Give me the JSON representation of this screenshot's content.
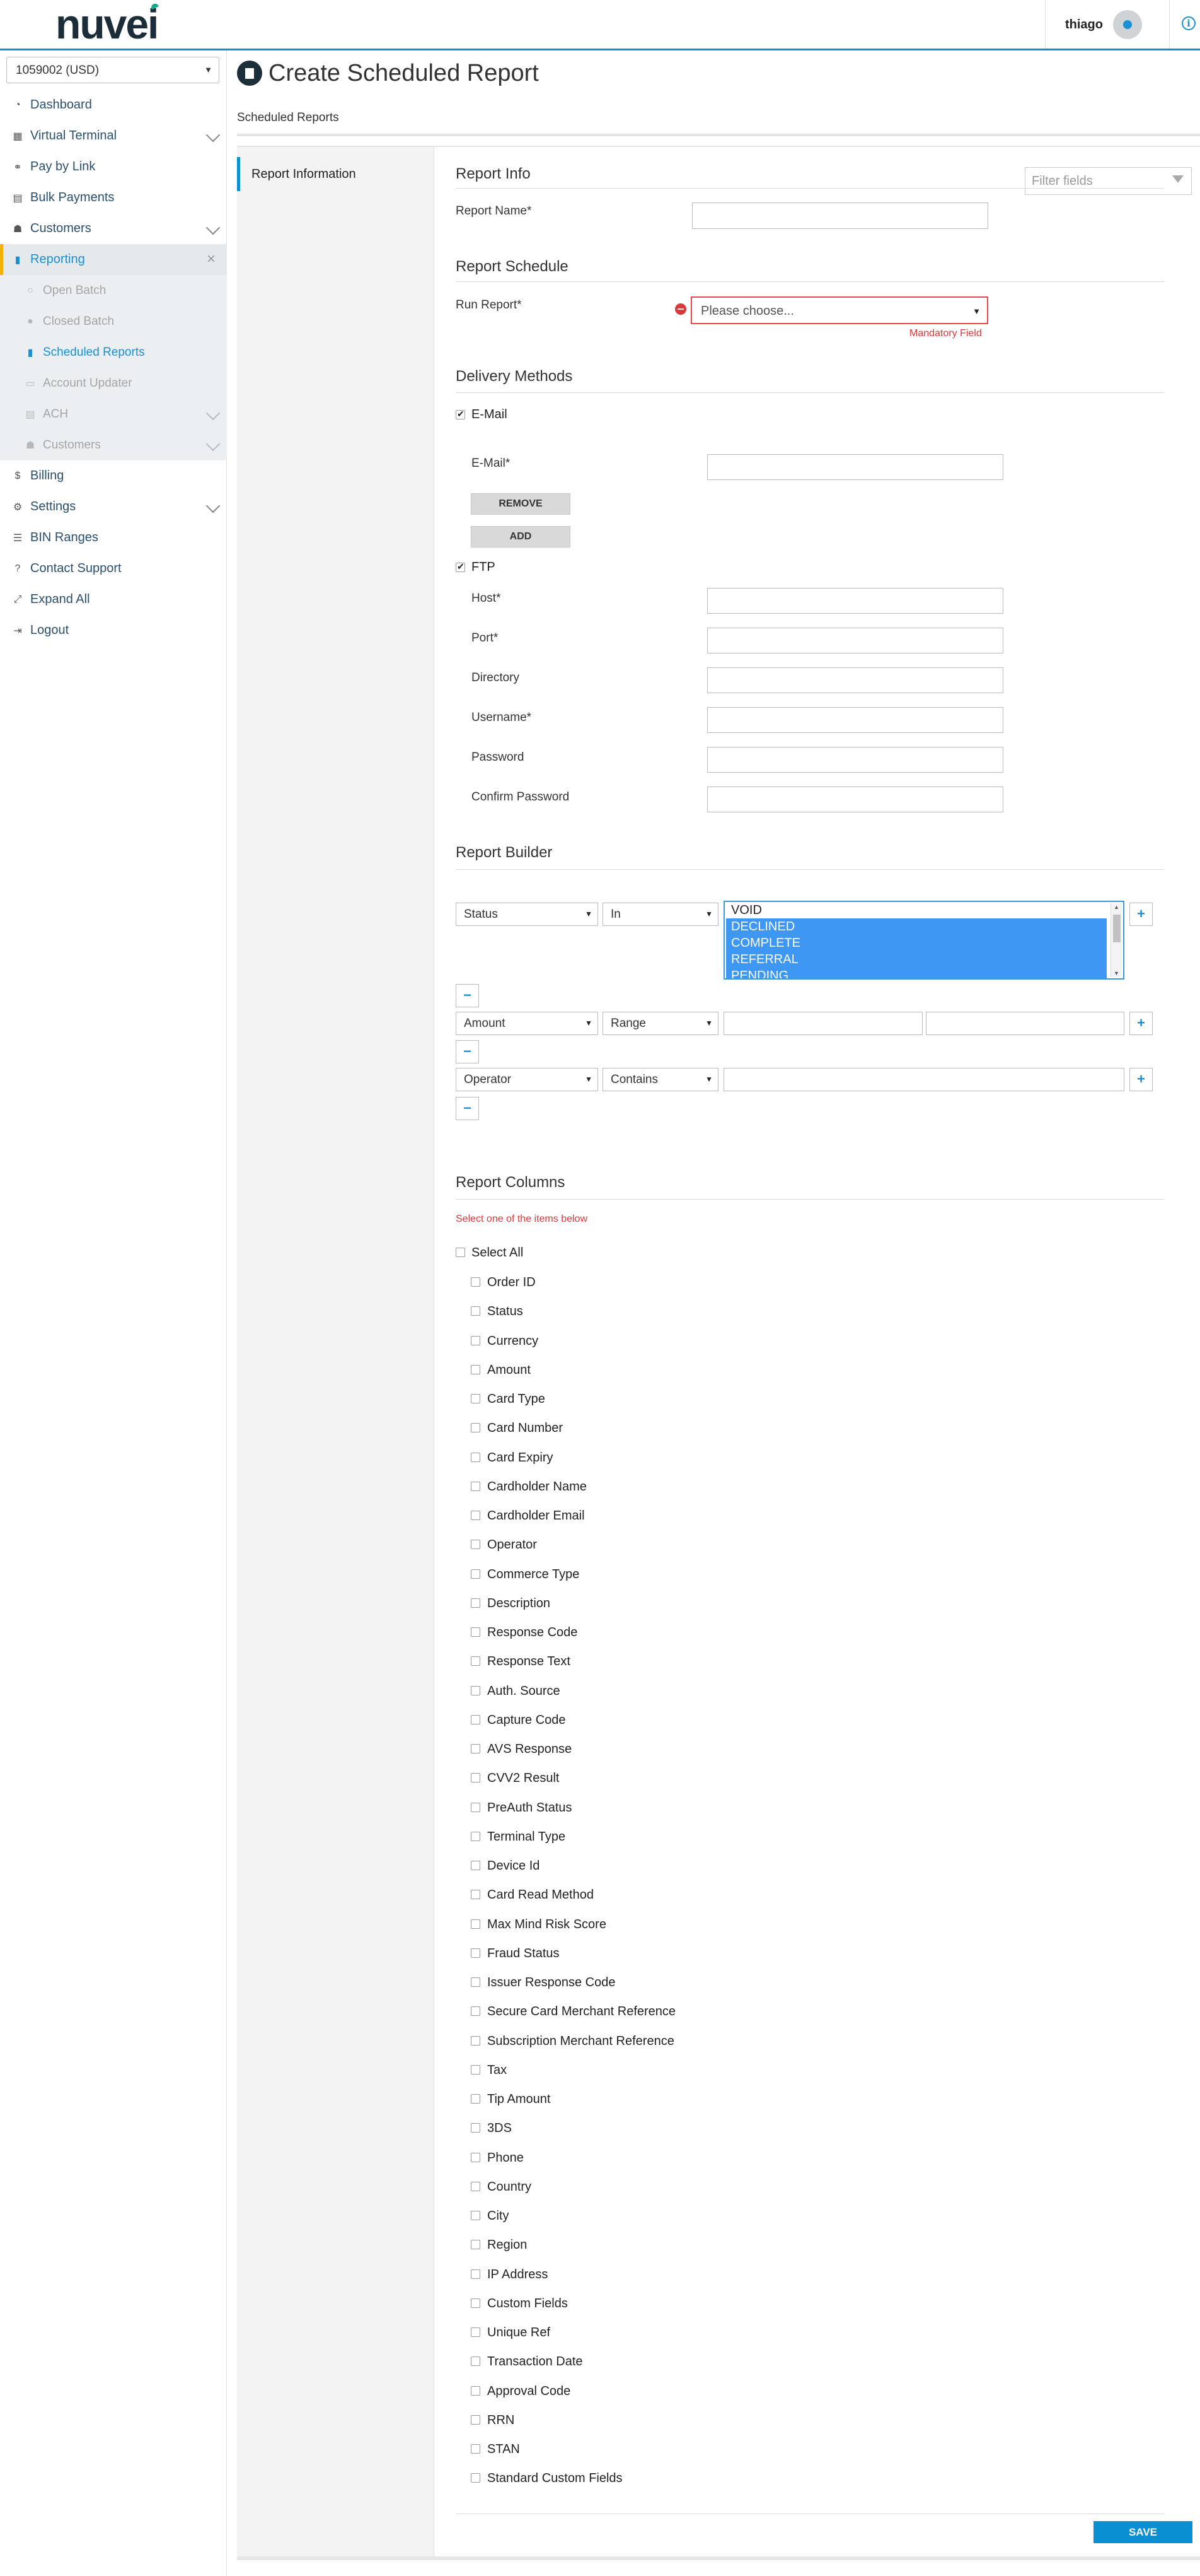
{
  "header": {
    "logo": "nuvei",
    "user_name": "thiago",
    "info_glyph": "i",
    "accent_color": "#0a8fd3"
  },
  "sidebar": {
    "account": "1059002 (USD)",
    "items": [
      {
        "label": "Dashboard",
        "icon": "dashboard-icon"
      },
      {
        "label": "Virtual Terminal",
        "icon": "calculator-icon"
      },
      {
        "label": "Pay by Link",
        "icon": "link-icon"
      },
      {
        "label": "Bulk Payments",
        "icon": "document-icon"
      },
      {
        "label": "Customers",
        "icon": "users-icon"
      },
      {
        "label": "Reporting",
        "icon": "report-icon"
      },
      {
        "label": "Billing",
        "icon": "dollar-icon"
      },
      {
        "label": "Settings",
        "icon": "gears-icon"
      },
      {
        "label": "BIN Ranges",
        "icon": "list-icon"
      },
      {
        "label": "Contact Support",
        "icon": "question-icon"
      },
      {
        "label": "Expand All",
        "icon": "expand-icon"
      },
      {
        "label": "Logout",
        "icon": "logout-icon"
      }
    ],
    "reporting_sub": [
      {
        "label": "Open Batch"
      },
      {
        "label": "Closed Batch"
      },
      {
        "label": "Scheduled Reports"
      },
      {
        "label": "Account Updater"
      },
      {
        "label": "ACH"
      },
      {
        "label": "Customers"
      }
    ]
  },
  "page": {
    "title": "Create Scheduled Report",
    "breadcrumb": "Scheduled Reports",
    "tab": "Report Information",
    "filter_placeholder": "Filter fields"
  },
  "form": {
    "report_info_title": "Report Info",
    "report_name_label": "Report Name*",
    "schedule_title": "Report Schedule",
    "run_report_label": "Run Report*",
    "run_report_value": "Please choose...",
    "mandatory_text": "Mandatory Field",
    "delivery_title": "Delivery Methods",
    "email_check_label": "E-Mail",
    "email_label": "E-Mail*",
    "remove_btn": "REMOVE",
    "add_btn": "ADD",
    "ftp_check_label": "FTP",
    "host_label": "Host*",
    "port_label": "Port*",
    "directory_label": "Directory",
    "username_label": "Username*",
    "password_label": "Password",
    "confirm_password_label": "Confirm Password"
  },
  "builder": {
    "title": "Report Builder",
    "rows": [
      {
        "field": "Status",
        "operator": "In"
      },
      {
        "field": "Amount",
        "operator": "Range"
      },
      {
        "field": "Operator",
        "operator": "Contains"
      }
    ],
    "status_options": [
      {
        "label": "VOID",
        "selected": false
      },
      {
        "label": "DECLINED",
        "selected": true
      },
      {
        "label": "COMPLETE",
        "selected": true
      },
      {
        "label": "REFERRAL",
        "selected": true
      },
      {
        "label": "PENDING",
        "selected": true
      }
    ],
    "plus": "+",
    "minus": "−"
  },
  "columns": {
    "title": "Report Columns",
    "hint": "Select one of the items below",
    "select_all": "Select All",
    "items": [
      "Order ID",
      "Status",
      "Currency",
      "Amount",
      "Card Type",
      "Card Number",
      "Card Expiry",
      "Cardholder Name",
      "Cardholder Email",
      "Operator",
      "Commerce Type",
      "Description",
      "Response Code",
      "Response Text",
      "Auth. Source",
      "Capture Code",
      "AVS Response",
      "CVV2 Result",
      "PreAuth Status",
      "Terminal Type",
      "Device Id",
      "Card Read Method",
      "Max Mind Risk Score",
      "Fraud Status",
      "Issuer Response Code",
      "Secure Card Merchant Reference",
      "Subscription Merchant Reference",
      "Tax",
      "Tip Amount",
      "3DS",
      "Phone",
      "Country",
      "City",
      "Region",
      "IP Address",
      "Custom Fields",
      "Unique Ref",
      "Transaction Date",
      "Approval Code",
      "RRN",
      "STAN",
      "Standard Custom Fields"
    ]
  },
  "save_btn": "SAVE"
}
